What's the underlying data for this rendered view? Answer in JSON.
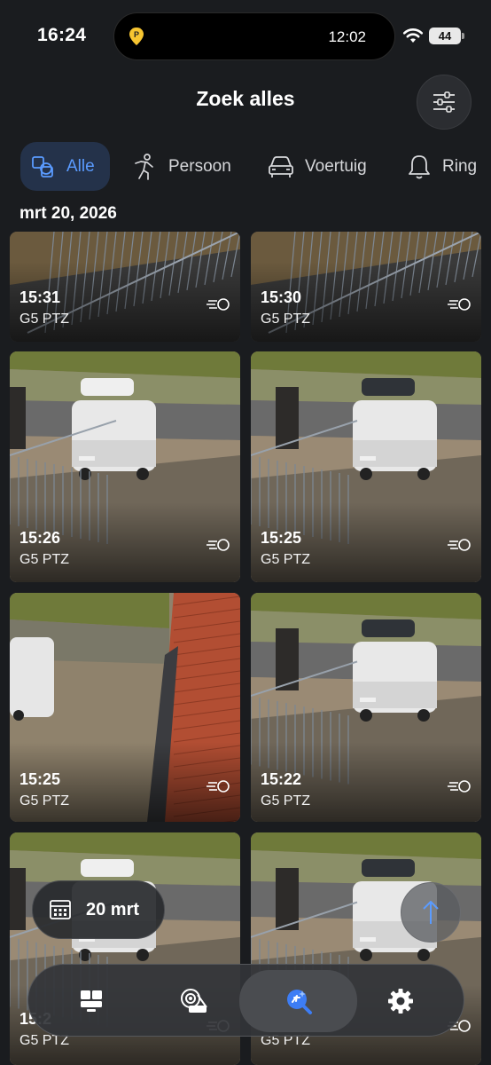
{
  "status_bar": {
    "time": "16:24",
    "island_time": "12:02",
    "battery": "44"
  },
  "header": {
    "title": "Zoek alles"
  },
  "filters": [
    {
      "label": "Alle",
      "icon": "objects-icon",
      "active": true
    },
    {
      "label": "Persoon",
      "icon": "person-icon",
      "active": false
    },
    {
      "label": "Voertuig",
      "icon": "car-icon",
      "active": false
    },
    {
      "label": "Ring",
      "icon": "bell-icon",
      "active": false
    }
  ],
  "section_date": "mrt 20, 2026",
  "events": [
    {
      "time": "15:31",
      "camera": "G5 PTZ"
    },
    {
      "time": "15:30",
      "camera": "G5 PTZ"
    },
    {
      "time": "15:26",
      "camera": "G5 PTZ"
    },
    {
      "time": "15:25",
      "camera": "G5 PTZ"
    },
    {
      "time": "15:25",
      "camera": "G5 PTZ"
    },
    {
      "time": "15:22",
      "camera": "G5 PTZ"
    },
    {
      "time": "15:2",
      "camera": "G5 PTZ"
    },
    {
      "time": "",
      "camera": "G5 PTZ"
    }
  ],
  "date_pill": {
    "label": "20 mrt",
    "icon": "calendar-icon"
  },
  "scroll_top": {
    "icon": "arrow-up-icon"
  },
  "bottom_nav": [
    {
      "icon": "dashboard-icon",
      "active": false
    },
    {
      "icon": "camera-icon",
      "active": false
    },
    {
      "icon": "search-icon",
      "active": true
    },
    {
      "icon": "gear-icon",
      "active": false
    }
  ],
  "colors": {
    "background": "#1a1c1f",
    "accent": "#5a9bff",
    "active_chip": "#24324a"
  }
}
